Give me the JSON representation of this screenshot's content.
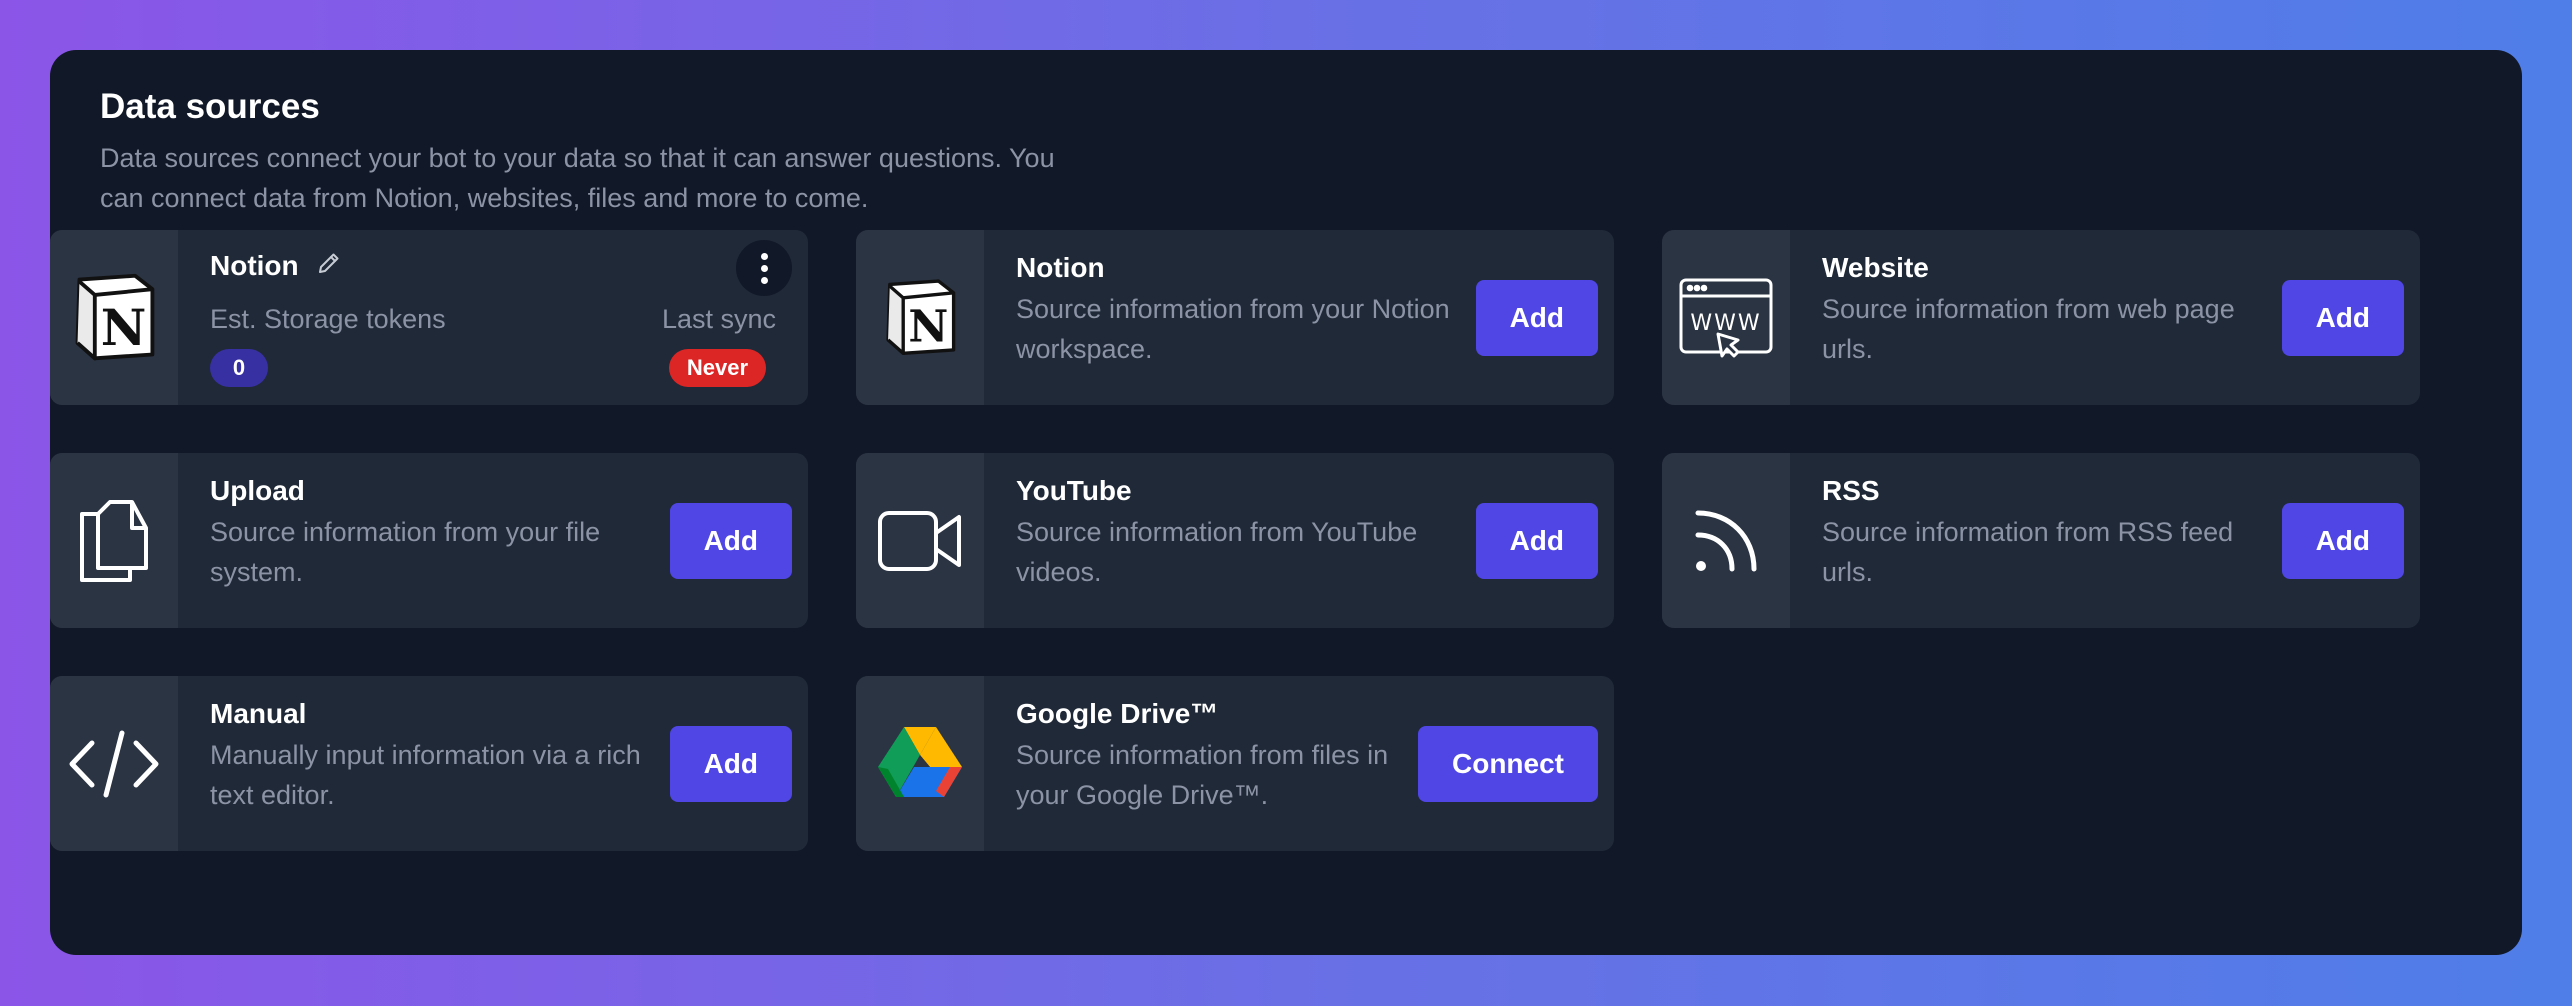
{
  "header": {
    "title": "Data sources",
    "description": "Data sources connect your bot to your data so that it can answer questions. You can connect data from Notion, websites, files and more to come."
  },
  "connected_source": {
    "name": "Notion",
    "icon": "notion-icon",
    "tokens_label": "Est. Storage tokens",
    "tokens_value": "0",
    "sync_label": "Last sync",
    "sync_value": "Never"
  },
  "sources": [
    {
      "title": "Notion",
      "description": "Source information from your Notion workspace.",
      "action": "Add",
      "icon": "notion-icon"
    },
    {
      "title": "Website",
      "description": "Source information from web page urls.",
      "action": "Add",
      "icon": "website-icon"
    },
    {
      "title": "Upload",
      "description": "Source information from your file system.",
      "action": "Add",
      "icon": "files-icon"
    },
    {
      "title": "YouTube",
      "description": "Source information from YouTube videos.",
      "action": "Add",
      "icon": "video-camera-icon"
    },
    {
      "title": "RSS",
      "description": "Source information from RSS feed urls.",
      "action": "Add",
      "icon": "rss-icon"
    },
    {
      "title": "Manual",
      "description": "Manually input information via a rich text editor.",
      "action": "Add",
      "icon": "code-icon"
    },
    {
      "title": "Google Drive™",
      "description": "Source information from files in your Google Drive™.",
      "action": "Connect",
      "icon": "google-drive-icon"
    }
  ],
  "colors": {
    "background_panel": "#111827",
    "card": "#1f2937",
    "primary_button": "#4f46e5",
    "tokens_badge": "#3730a3",
    "sync_badge": "#dc2626"
  }
}
